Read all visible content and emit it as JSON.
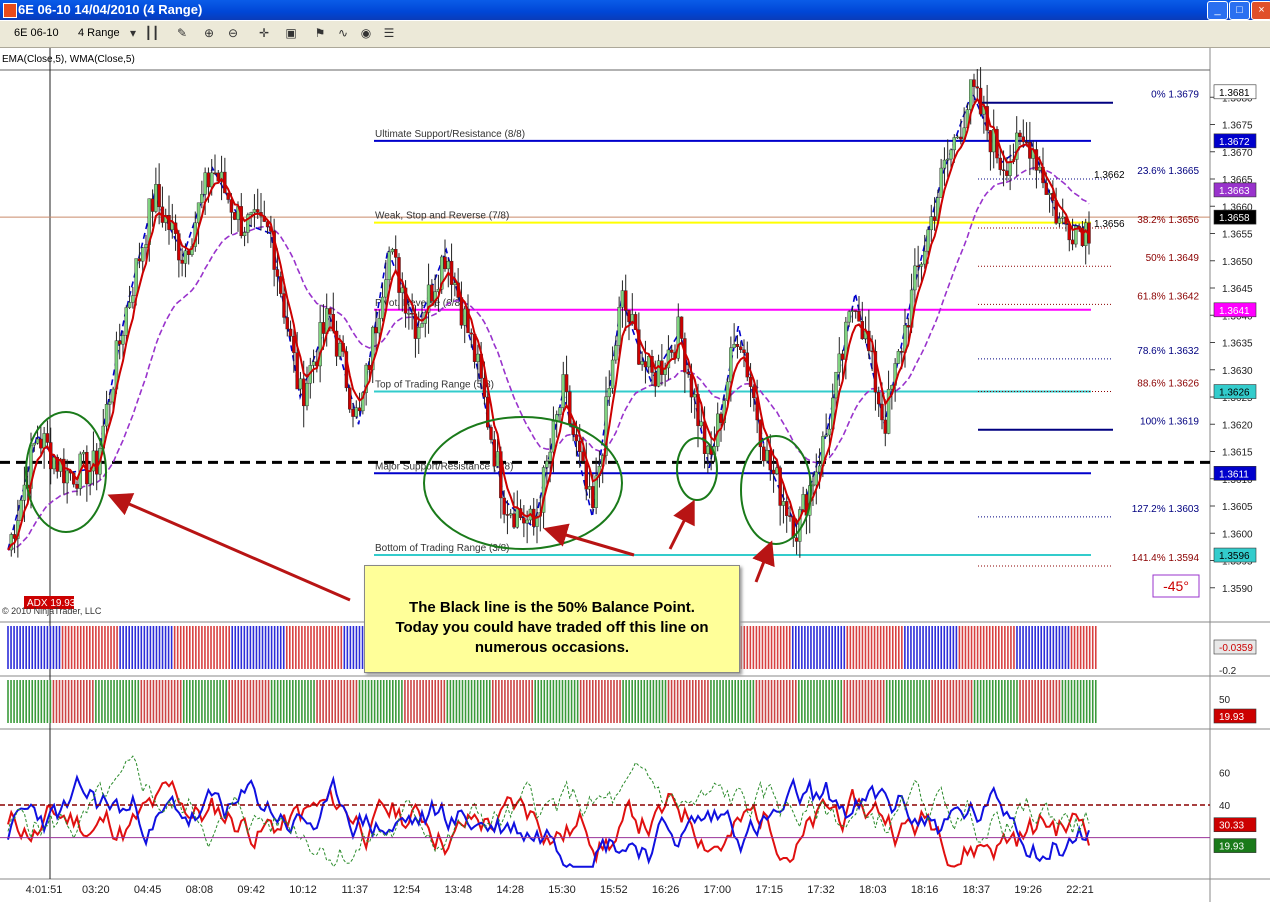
{
  "window": {
    "title": "6E 06-10  14/04/2010 (4 Range)"
  },
  "toolbar": {
    "instrument": "6E 06-10",
    "period": "4 Range"
  },
  "indicator_label": "EMA(Close,5), WMA(Close,5)",
  "callout_lines": [
    "The Black line is the 50% Balance Point.",
    "Today you could have traded off this line on",
    "numerous occasions."
  ],
  "colors": {
    "bull": "#2e8b2e",
    "bear": "#cc0000",
    "ema": "#9933cc",
    "zigzag": "#0000cc",
    "balance": "#000000"
  },
  "chart_data": [
    {
      "type": "candlestick",
      "ylim": [
        1.3585,
        1.3685
      ],
      "yticks": [
        "1.3680",
        "1.3675",
        "1.3670",
        "1.3665",
        "1.3660",
        "1.3655",
        "1.3650",
        "1.3645",
        "1.3640",
        "1.3635",
        "1.3630",
        "1.3625",
        "1.3620",
        "1.3615",
        "1.3610",
        "1.3605",
        "1.3600",
        "1.3595",
        "1.3590"
      ],
      "x_labels": [
        "4:01:51",
        "03:20",
        "04:45",
        "08:08",
        "09:42",
        "10:12",
        "11:37",
        "12:54",
        "13:48",
        "14:28",
        "15:30",
        "15:52",
        "16:26",
        "17:00",
        "17:15",
        "17:32",
        "18:03",
        "18:16",
        "18:37",
        "19:26",
        "22:21"
      ],
      "price_path": [
        1.3597,
        1.3618,
        1.3611,
        1.3612,
        1.364,
        1.3662,
        1.3651,
        1.3667,
        1.3657,
        1.3655,
        1.3625,
        1.364,
        1.362,
        1.3652,
        1.3638,
        1.3652,
        1.3632,
        1.3606,
        1.3601,
        1.3626,
        1.3603,
        1.3643,
        1.3628,
        1.3637,
        1.3612,
        1.3638,
        1.3613,
        1.3601,
        1.3618,
        1.3644,
        1.362,
        1.3645,
        1.3666,
        1.3681,
        1.3668,
        1.3672,
        1.3657,
        1.3656
      ],
      "murrey_levels": [
        {
          "label": "Ultimate Support/Resistance (8/8)",
          "value": 1.3672,
          "color": "#0000cc",
          "tag": "1.3672"
        },
        {
          "label": "Weak, Stop and Reverse (7/8)",
          "value": 1.3657,
          "color": "#ffff00",
          "tag": "1.3658"
        },
        {
          "label": "Pivot, Reverse (6/8)",
          "value": 1.3641,
          "color": "#ff00ff",
          "tag": "1.3641"
        },
        {
          "label": "Top of Trading Range (5/8)",
          "value": 1.3626,
          "color": "#33cccc",
          "tag": "1.3626"
        },
        {
          "label": "Major Support/Resistance (4/8)",
          "value": 1.3611,
          "color": "#0000cc",
          "tag": "1.3611"
        },
        {
          "label": "Bottom of Trading Range (3/8)",
          "value": 1.3596,
          "color": "#33cccc",
          "tag": "1.3596"
        }
      ],
      "balance_line": 1.3613,
      "fib_levels": [
        {
          "label": "0%  1.3679",
          "value": 1.3679,
          "color": "#000080"
        },
        {
          "label": "23.6%  1.3665",
          "value": 1.3665,
          "color": "#000080"
        },
        {
          "label": "38.2%  1.3656",
          "value": 1.3656,
          "color": "#8b0000"
        },
        {
          "label": "50%  1.3649",
          "value": 1.3649,
          "color": "#8b0000"
        },
        {
          "label": "61.8%  1.3642",
          "value": 1.3642,
          "color": "#8b0000"
        },
        {
          "label": "78.6%  1.3632",
          "value": 1.3632,
          "color": "#000080"
        },
        {
          "label": "88.6%  1.3626",
          "value": 1.3626,
          "color": "#8b0000"
        },
        {
          "label": "100%  1.3619",
          "value": 1.3619,
          "color": "#000080"
        },
        {
          "label": "127.2%  1.3603",
          "value": 1.3603,
          "color": "#000080"
        },
        {
          "label": "141.4%  1.3594",
          "value": 1.3594,
          "color": "#8b0000"
        }
      ],
      "price_tags": [
        {
          "text": "1.3681",
          "value": 1.3681,
          "bg": "#ffffff",
          "fg": "#000000"
        },
        {
          "text": "1.3663",
          "value": 1.3663,
          "bg": "#9933cc",
          "fg": "#ffffff"
        },
        {
          "text": "1.3658",
          "value": 1.3658,
          "bg": "#000000",
          "fg": "#ffffff"
        }
      ],
      "annotations": [
        "1.3662",
        "1.3656",
        "-45°",
        "ADX 19.93",
        "© 2010 NinjaTrader, LLC"
      ]
    },
    {
      "type": "bar",
      "name": "momentum",
      "tag": "-0.0359",
      "yticks": [
        "-0.2"
      ]
    },
    {
      "type": "bar",
      "name": "trend",
      "tag": "19.93",
      "yticks": [
        "50"
      ]
    },
    {
      "type": "line",
      "name": "DMI/ADX",
      "yticks": [
        "60",
        "40",
        "30.33",
        "19.93"
      ],
      "ylim": [
        0,
        80
      ],
      "reference": 40
    }
  ]
}
